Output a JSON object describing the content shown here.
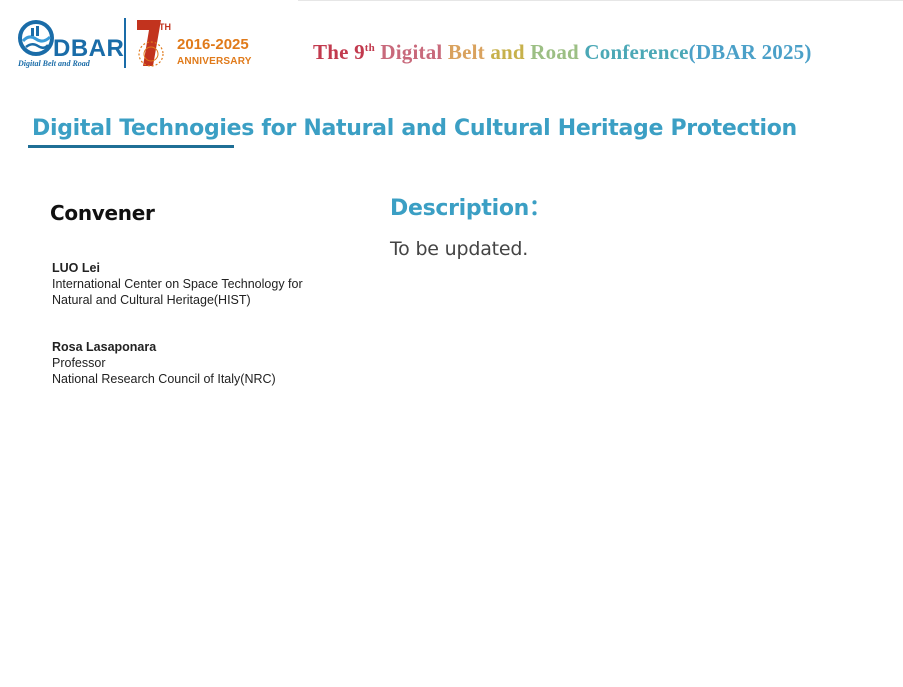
{
  "header": {
    "logo_text": "DBAR",
    "logo_tagline": "Digital Belt and Road",
    "anniversary_years": "2016-2025",
    "anniversary_label": "ANNIVERSARY",
    "anniversary_number": "1",
    "anniversary_suffix": "TH",
    "conference_title": {
      "the": "The",
      "nine": "9",
      "sup": "th",
      "digital": "Digital",
      "belt": "Belt",
      "and": "and",
      "road": "Road",
      "conference": "Conference",
      "dbar_year": "(DBAR 2025)"
    },
    "colors": {
      "the": "#c23a4e",
      "nine": "#c23a4e",
      "digital": "#c8697b",
      "belt": "#d9a25e",
      "and": "#c7b14b",
      "road": "#9cbf84",
      "conference": "#4ba8b6",
      "dbar_year": "#4ba0c8"
    }
  },
  "session": {
    "title": "Digital Technogies for Natural and Cultural Heritage Protection"
  },
  "convener": {
    "heading": "Convener",
    "people": [
      {
        "name": "LUO Lei",
        "lines": [
          "International Center on Space Technology for",
          "Natural and Cultural Heritage(HIST)"
        ]
      },
      {
        "name": "Rosa Lasaponara",
        "lines": [
          "Professor",
          "National Research Council of Italy(NRC)"
        ]
      }
    ]
  },
  "description": {
    "heading": "Description：",
    "body": "To be updated."
  }
}
